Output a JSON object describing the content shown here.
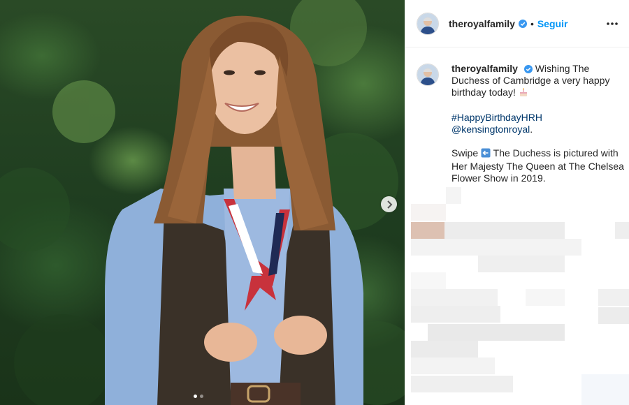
{
  "header": {
    "username": "theroyalfamily",
    "separator": "•",
    "follow_label": "Seguir"
  },
  "caption": {
    "username": "theroyalfamily",
    "line1": "Wishing The Duchess of Cambridge a very happy birthday today!",
    "hashtag": "#HappyBirthdayHRH",
    "mention": "@kensingtonroyal",
    "mention_suffix": ".",
    "swipe_word": "Swipe",
    "line3": "The Duchess is pictured with Her Majesty The Queen at The Chelsea Flower Show in 2019."
  },
  "carousel": {
    "current_slide": 1,
    "total_slides": 2
  },
  "icons": {
    "verified": "verified-badge-icon",
    "more": "more-options-icon",
    "next": "chevron-right-icon",
    "birthday": "birthday-cake-emoji",
    "swipe": "left-arrow-emoji"
  },
  "colors": {
    "accent": "#0095f6",
    "link": "#00376b",
    "verified": "#3897f0"
  }
}
